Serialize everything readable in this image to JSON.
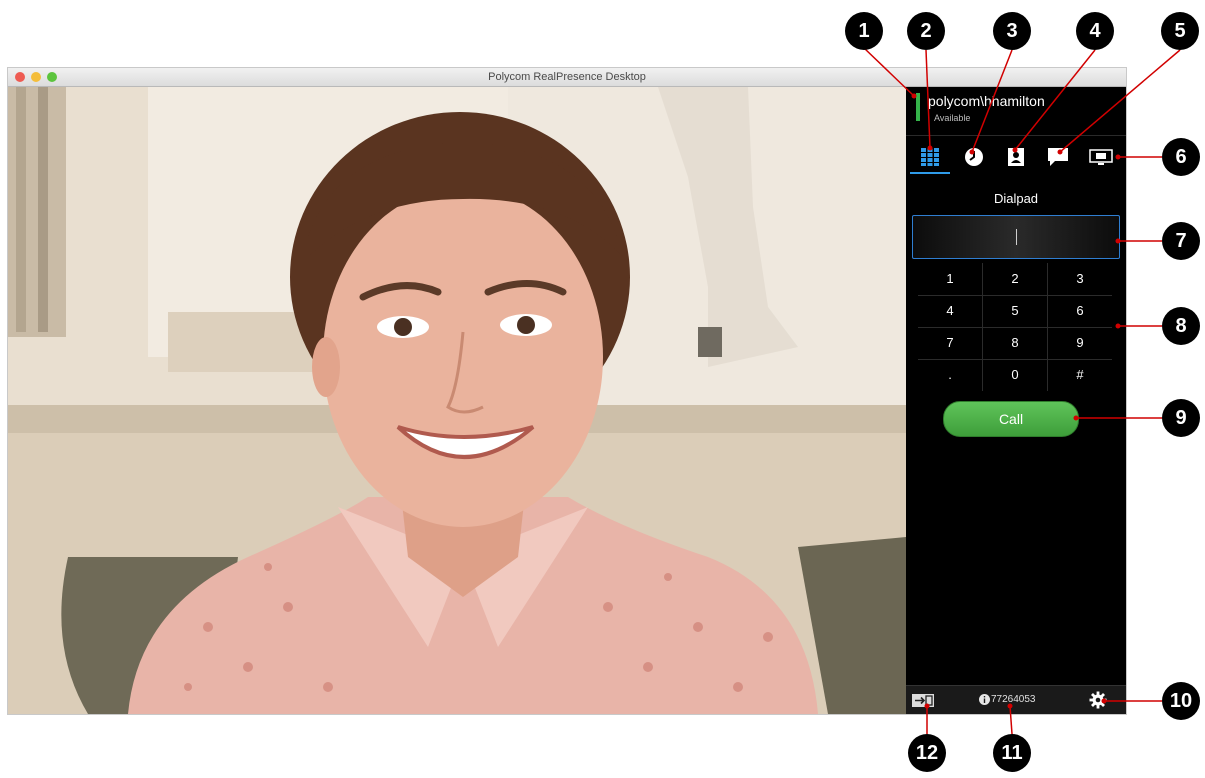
{
  "window": {
    "title": "Polycom RealPresence Desktop"
  },
  "user": {
    "name": "polycom\\hhamilton",
    "status": "Available"
  },
  "nav": {
    "tabs": [
      {
        "icon": "dialpad-icon",
        "active": true
      },
      {
        "icon": "clock-icon"
      },
      {
        "icon": "contacts-icon"
      },
      {
        "icon": "chat-icon"
      },
      {
        "icon": "content-share-icon"
      }
    ]
  },
  "dialpad": {
    "title": "Dialpad",
    "input_value": "",
    "keys": [
      "1",
      "2",
      "3",
      "4",
      "5",
      "6",
      "7",
      "8",
      "9",
      ".",
      "0",
      "#"
    ],
    "call_label": "Call"
  },
  "footer": {
    "meeting_id": "77264053"
  },
  "callouts": [
    "1",
    "2",
    "3",
    "4",
    "5",
    "6",
    "7",
    "8",
    "9",
    "10",
    "11",
    "12"
  ],
  "colors": {
    "accent_blue": "#2f9be8",
    "call_green": "#4bb446",
    "presence_green": "#35b34a"
  }
}
